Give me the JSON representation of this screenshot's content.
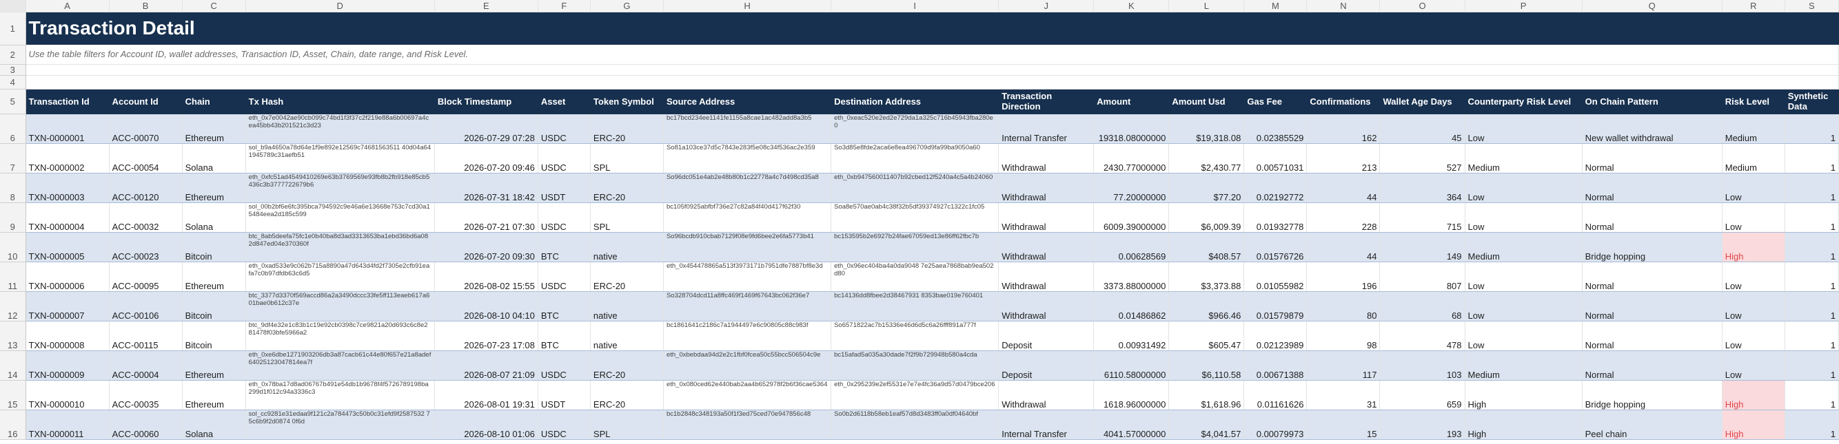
{
  "column_letters": [
    "A",
    "B",
    "C",
    "D",
    "E",
    "F",
    "G",
    "H",
    "I",
    "J",
    "K",
    "L",
    "M",
    "N",
    "O",
    "P",
    "Q",
    "R",
    "S"
  ],
  "row_numbers": [
    "1",
    "2",
    "3",
    "4",
    "5",
    "6",
    "7",
    "8",
    "9",
    "10",
    "11",
    "12",
    "13",
    "14",
    "15",
    "16"
  ],
  "title": "Transaction Detail",
  "note": "Use the table filters for Account ID, wallet addresses, Transaction ID, Asset, Chain, date range, and Risk Level.",
  "headers": [
    "Transaction Id",
    "Account Id",
    "Chain",
    "Tx Hash",
    "Block Timestamp",
    "Asset",
    "Token Symbol",
    "Source Address",
    "Destination Address",
    "Transaction Direction",
    "Amount",
    "Amount Usd",
    "Gas Fee",
    "Confirmations",
    "Wallet Age Days",
    "Counterparty Risk Level",
    "On Chain Pattern",
    "Risk Level",
    "Synthetic Data"
  ],
  "colors": {
    "header_bg": "#17304f",
    "band": "#dbe4f0",
    "high_bg": "#fadadd",
    "high_text": "#e0454a"
  },
  "rows": [
    {
      "txid": "TXN-0000001",
      "acct": "ACC-00070",
      "chain": "Ethereum",
      "hash": "eth_0x7e0042ae90cb099c74bd1f3f37c2f219e88a6b00697a4cea45bb43b201521c3d23",
      "ts": "2026-07-29 07:28",
      "asset": "USDC",
      "token": "ERC-20",
      "src": "bc17bcd234ee1141fe1155a8cae1ac482add8a3b5",
      "dst": "eth_0xeac520e2ed2e729da1a325c716b45943fba280e0",
      "dir": "Internal Transfer",
      "amount": "19318.08000000",
      "usd": "$19,318.08",
      "gas": "0.02385529",
      "conf": "162",
      "age": "45",
      "cp": "Low",
      "pattern": "New wallet withdrawal",
      "risk": "Medium",
      "synth": "1"
    },
    {
      "txid": "TXN-0000002",
      "acct": "ACC-00054",
      "chain": "Solana",
      "hash": "sol_b9a4650a78d64e1f9e892e12569c74681563511 40d04a641945789c31aefb51",
      "ts": "2026-07-20 09:46",
      "asset": "USDC",
      "token": "SPL",
      "src": "So81a103ce37d5c7843e283f5e08c34f536ac2e359",
      "dst": "So3d85e8fde2aca6e8ea496709d9fa99ba9050a60",
      "dir": "Withdrawal",
      "amount": "2430.77000000",
      "usd": "$2,430.77",
      "gas": "0.00571031",
      "conf": "213",
      "age": "527",
      "cp": "Medium",
      "pattern": "Normal",
      "risk": "Medium",
      "synth": "1"
    },
    {
      "txid": "TXN-0000003",
      "acct": "ACC-00120",
      "chain": "Ethereum",
      "hash": "eth_0xfc51ad4549410269e63b3769569e93fb8b2fb918e85cb5436c3b3777722679b6",
      "ts": "2026-07-31 18:42",
      "asset": "USDT",
      "token": "ERC-20",
      "src": "So96dc051e4ab2e48b80b1c22778a4c7d498cd35a8",
      "dst": "eth_0xb947560011407b92cbed12f5240a4c5a4b24060",
      "dir": "Withdrawal",
      "amount": "77.20000000",
      "usd": "$77.20",
      "gas": "0.02192772",
      "conf": "44",
      "age": "364",
      "cp": "Low",
      "pattern": "Normal",
      "risk": "Low",
      "synth": "1"
    },
    {
      "txid": "TXN-0000004",
      "acct": "ACC-00032",
      "chain": "Solana",
      "hash": "sol_00b2bf6e6fc395bca794592c9e46a6e13668e753c7cd30a15484eea2d185c599",
      "ts": "2026-07-21 07:30",
      "asset": "USDC",
      "token": "SPL",
      "src": "bc105f0925abfbf736e27c82a84f40d417f62f30",
      "dst": "Soa8e570ae0ab4c38f32b5df39374927c1322c1fc05",
      "dir": "Withdrawal",
      "amount": "6009.39000000",
      "usd": "$6,009.39",
      "gas": "0.01932778",
      "conf": "228",
      "age": "715",
      "cp": "Low",
      "pattern": "Normal",
      "risk": "Low",
      "synth": "1"
    },
    {
      "txid": "TXN-0000005",
      "acct": "ACC-00023",
      "chain": "Bitcoin",
      "hash": "btc_8ab5deefa75fc1e0b40ba8d3ad3313653ba1ebd36bd6a082d847ed04e370360f",
      "ts": "2026-07-20 09:30",
      "asset": "BTC",
      "token": "native",
      "src": "So96bcdb910cbab7129f08e9fd6bee2e6fa5773b41",
      "dst": "bc153595b2e6927b24fae67059ed13e86ff62fbc7b",
      "dir": "Withdrawal",
      "amount": "0.00628569",
      "usd": "$408.57",
      "gas": "0.01576726",
      "conf": "44",
      "age": "149",
      "cp": "Medium",
      "pattern": "Bridge hopping",
      "risk": "High",
      "synth": "1"
    },
    {
      "txid": "TXN-0000006",
      "acct": "ACC-00095",
      "chain": "Ethereum",
      "hash": "eth_0xad533e9c062b715a8890a47d643d4fd2f7305e2cfb91eafa7c0b97dfdb63c6d5",
      "ts": "2026-08-02 15:55",
      "asset": "USDC",
      "token": "ERC-20",
      "src": "eth_0x454478865a513f3973171b7951dfe7887bf8e3d",
      "dst": "eth_0x96ec404ba4a0da9048 7e25aea7868bab9ea502d80",
      "dir": "Withdrawal",
      "amount": "3373.88000000",
      "usd": "$3,373.88",
      "gas": "0.01055982",
      "conf": "196",
      "age": "807",
      "cp": "Low",
      "pattern": "Normal",
      "risk": "Low",
      "synth": "1"
    },
    {
      "txid": "TXN-0000007",
      "acct": "ACC-00106",
      "chain": "Bitcoin",
      "hash": "btc_3377d3370f569accd86a2a3490dccc33fe5ff113eaeb617a601bae0b612c37e",
      "ts": "2026-08-10 04:10",
      "asset": "BTC",
      "token": "native",
      "src": "So328704dcd11a8ffc469f1469f67643bc062f36e7",
      "dst": "bc14136dd8fbee2d38467931 8353bae019e760401",
      "dir": "Withdrawal",
      "amount": "0.01486862",
      "usd": "$966.46",
      "gas": "0.01579879",
      "conf": "80",
      "age": "68",
      "cp": "Low",
      "pattern": "Normal",
      "risk": "Low",
      "synth": "1"
    },
    {
      "txid": "TXN-0000008",
      "acct": "ACC-00115",
      "chain": "Bitcoin",
      "hash": "btc_9df4e32e1c83b1c19e92cb0398c7ce9821a20d693c6c8e281478f03bfe5966a2",
      "ts": "2026-07-23 17:08",
      "asset": "BTC",
      "token": "native",
      "src": "bc1861641c2186c7a1944497e6c90805c88c983f",
      "dst": "So6571822ac7b15336e46d6d5c6a26fff891a777f",
      "dir": "Deposit",
      "amount": "0.00931492",
      "usd": "$605.47",
      "gas": "0.02123989",
      "conf": "98",
      "age": "478",
      "cp": "Low",
      "pattern": "Normal",
      "risk": "Low",
      "synth": "1"
    },
    {
      "txid": "TXN-0000009",
      "acct": "ACC-00004",
      "chain": "Ethereum",
      "hash": "eth_0xe6dbe1271903206db3a87cacb61c44e80f657e21a8adef64025123047814ea7f",
      "ts": "2026-08-07 21:09",
      "asset": "USDC",
      "token": "ERC-20",
      "src": "eth_0xbebdaa94d2e2c1fbf0fcea50c55bcc506504c9e",
      "dst": "bc15afad5a035a30dade7f2f9b729948b580a4cda",
      "dir": "Deposit",
      "amount": "6110.58000000",
      "usd": "$6,110.58",
      "gas": "0.00671388",
      "conf": "117",
      "age": "103",
      "cp": "Medium",
      "pattern": "Normal",
      "risk": "Low",
      "synth": "1"
    },
    {
      "txid": "TXN-0000010",
      "acct": "ACC-00035",
      "chain": "Ethereum",
      "hash": "eth_0x78ba17d8ad06767b491e54db1b9678f4f5726789198ba299d1f012c94a3336c3",
      "ts": "2026-08-01 19:31",
      "asset": "USDT",
      "token": "ERC-20",
      "src": "eth_0x080ced62e440bab2aa4b652978f2b6f36cae5364",
      "dst": "eth_0x295239e2ef5531e7e7e4fc36a9d57d0479bce206",
      "dir": "Withdrawal",
      "amount": "1618.96000000",
      "usd": "$1,618.96",
      "gas": "0.01161626",
      "conf": "31",
      "age": "659",
      "cp": "High",
      "pattern": "Bridge hopping",
      "risk": "High",
      "synth": "1"
    },
    {
      "txid": "TXN-0000011",
      "acct": "ACC-00060",
      "chain": "Solana",
      "hash": "sol_cc9281e31edaa9f121c2a784473c50b0c31efd9f2587532 75c6b9f2d0874 0f6d",
      "ts": "2026-08-10 01:06",
      "asset": "USDC",
      "token": "SPL",
      "src": "bc1b2848c348193a50f1f3ed75ced70e947856c48",
      "dst": "So0b2d6118b58eb1eaf57d8d3483ff0a0df04640bf",
      "dir": "Internal Transfer",
      "amount": "4041.57000000",
      "usd": "$4,041.57",
      "gas": "0.00079973",
      "conf": "15",
      "age": "193",
      "cp": "High",
      "pattern": "Peel chain",
      "risk": "High",
      "synth": "1"
    }
  ]
}
